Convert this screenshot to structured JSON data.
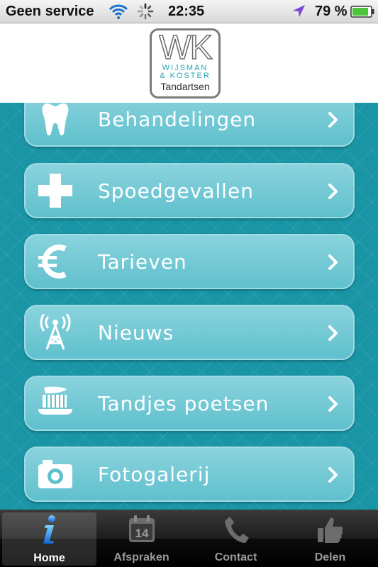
{
  "status_bar": {
    "carrier": "Geen service",
    "time": "22:35",
    "battery": "79 %",
    "icons": [
      "wifi-icon",
      "activity-spinner-icon",
      "location-arrow-icon",
      "battery-icon"
    ]
  },
  "header": {
    "logo": {
      "monogram": "WK",
      "names_line1": "WIJSMAN",
      "names_line2": "& KOSTER",
      "subtitle": "Tandartsen"
    }
  },
  "menu": {
    "items": [
      {
        "label": "Behandelingen",
        "icon": "tooth-icon"
      },
      {
        "label": "Spoedgevallen",
        "icon": "cross-icon"
      },
      {
        "label": "Tarieven",
        "icon": "euro-icon"
      },
      {
        "label": "Nieuws",
        "icon": "antenna-icon"
      },
      {
        "label": "Tandjes poetsen",
        "icon": "toothbrush-icon"
      },
      {
        "label": "Fotogalerij",
        "icon": "camera-icon"
      }
    ]
  },
  "tab_bar": {
    "tabs": [
      {
        "label": "Home",
        "icon": "info-icon",
        "active": true
      },
      {
        "label": "Afspraken",
        "icon": "calendar-icon",
        "badge": "14"
      },
      {
        "label": "Contact",
        "icon": "phone-icon"
      },
      {
        "label": "Delen",
        "icon": "thumbs-up-icon"
      }
    ]
  },
  "colors": {
    "accent": "#1995a5",
    "button": "#6fc8d4",
    "tab_bar": "#111111"
  }
}
